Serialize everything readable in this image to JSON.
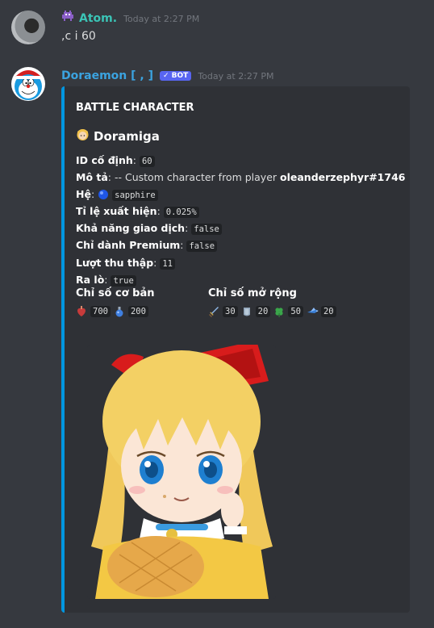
{
  "message1": {
    "username": "Atom.",
    "timestamp": "Today at 2:27 PM",
    "text": ",c i 60",
    "username_color": "#3bc4b6"
  },
  "message2": {
    "username": "Doraemon [ , ]",
    "bot_tag": "✓ BOT",
    "timestamp": "Today at 2:27 PM",
    "username_color": "#3ba3e0"
  },
  "embed": {
    "accent_color": "#0096e0",
    "title": "BATTLE CHARACTER",
    "character_name": "Doramiga",
    "fields": {
      "id_label": "ID cố định",
      "id_value": "60",
      "desc_label": "Mô tả",
      "desc_text": "-- Custom character from player ",
      "desc_player": "oleanderzephyr#1746",
      "element_label": "Hệ",
      "element_value": "sapphire",
      "rate_label": "Tỉ lệ xuất hiện",
      "rate_value": "0.025%",
      "trade_label": "Khả năng giao dịch",
      "trade_value": "false",
      "premium_label": "Chỉ dành Premium",
      "premium_value": "false",
      "collect_label": "Lượt thu thập",
      "collect_value": "11",
      "dungeon_label": "Ra lò",
      "dungeon_value": "true"
    },
    "base_stats": {
      "heading": "Chỉ số cơ bản",
      "hp": "700",
      "mana": "200"
    },
    "extended_stats": {
      "heading": "Chỉ số mở rộng",
      "attack": "30",
      "defense": "20",
      "luck": "50",
      "speed": "20"
    }
  }
}
